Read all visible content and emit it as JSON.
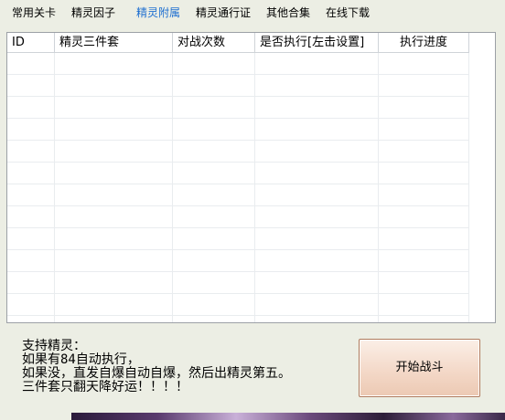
{
  "tabs": [
    {
      "label": "常用关卡",
      "active": false
    },
    {
      "label": "精灵因子",
      "active": false
    },
    {
      "label": "精灵附属",
      "active": true
    },
    {
      "label": "精灵通行证",
      "active": false
    },
    {
      "label": "其他合集",
      "active": false
    },
    {
      "label": "在线下载",
      "active": false
    }
  ],
  "table": {
    "columns": [
      "ID",
      "精灵三件套",
      "对战次数",
      "是否执行[左击设置]",
      "执行进度"
    ],
    "rows": []
  },
  "support_text": [
    "支持精灵：",
    "如果有84自动执行，",
    "如果没，直发自爆自动自爆，然后出精灵第五。",
    "三件套只翻天降好运！！！！"
  ],
  "start_button": {
    "label": "开始战斗"
  },
  "colors": {
    "active_tab": "#1e6fd0",
    "window_bg": "#eceee4",
    "button_bg": "#f3d7c6"
  }
}
